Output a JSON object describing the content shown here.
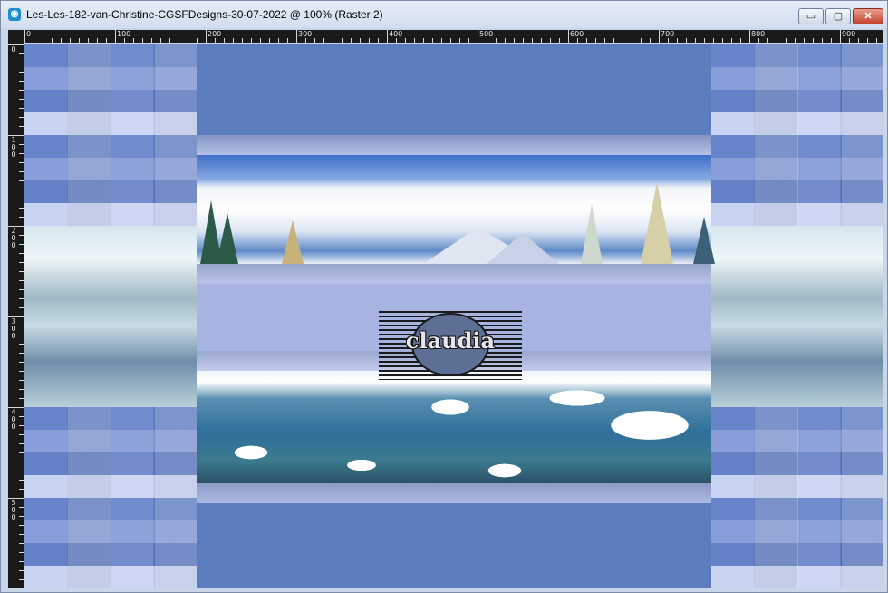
{
  "window": {
    "title": "Les-Les-182-van-Christine-CGSFDesigns-30-07-2022 @ 100% (Raster 2)",
    "buttons": {
      "minimize": "▭",
      "maximize": "▢",
      "close": "✕"
    }
  },
  "ruler": {
    "top_labels": [
      "0",
      "100",
      "200",
      "300",
      "400",
      "500",
      "600",
      "700",
      "800",
      "900"
    ],
    "left_labels": [
      "0",
      "100",
      "200",
      "300",
      "400",
      "500"
    ]
  },
  "canvas": {
    "logo_text": "claudia",
    "colors": {
      "background": "#5c7dbd",
      "center_band": "#a4b1de"
    }
  }
}
